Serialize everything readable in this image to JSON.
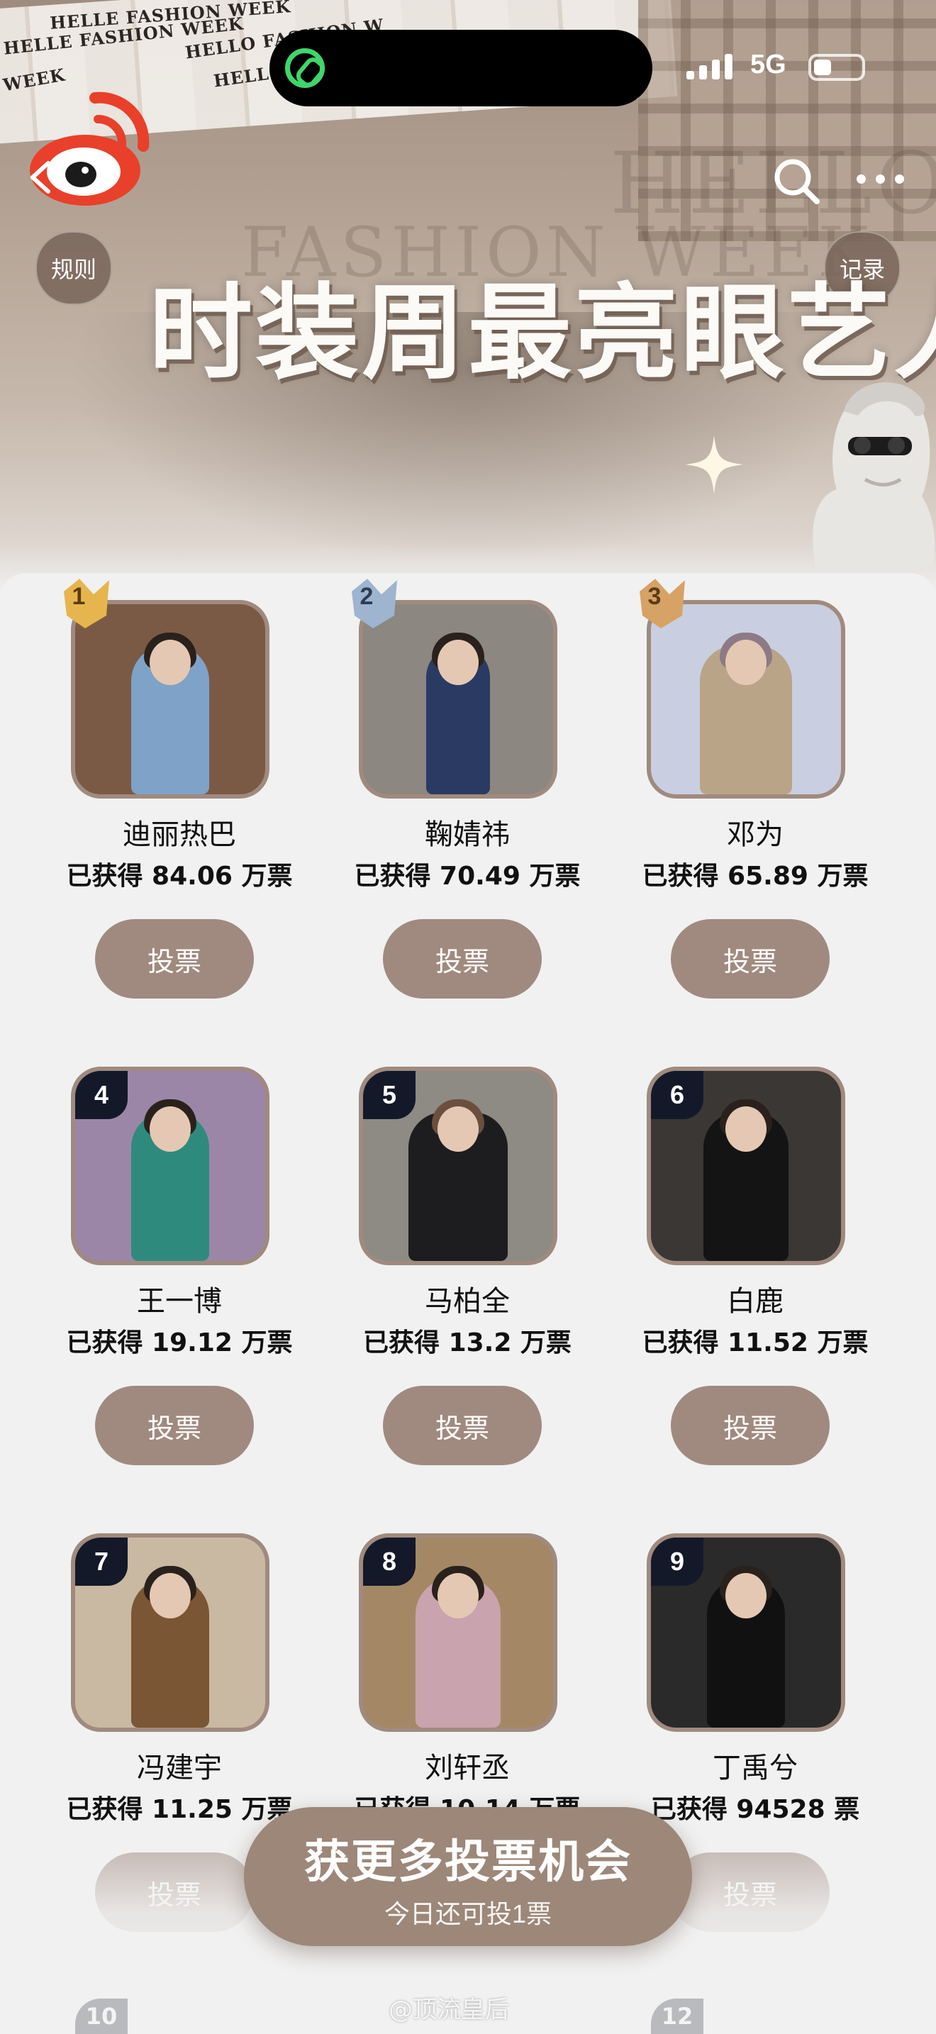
{
  "status_bar": {
    "network": "5G"
  },
  "header": {
    "title": "时装周最亮眼艺人",
    "rules_label": "规则",
    "records_label": "记录",
    "collage_words": [
      "HELLE FASHION WEEK",
      "HELLO FASHION W",
      "HELLO FASHION W",
      "HELLE FASHION WEEK",
      "WEEK"
    ],
    "background_word": "FASHION WEEK",
    "background_word_2": "HELLO"
  },
  "artists": [
    {
      "rank": "1",
      "name": "迪丽热巴",
      "votes": "已获得 84.06 万票",
      "vote_label": "投票",
      "photo_bg": "#7a5a44",
      "outfit": "#7fa2c8"
    },
    {
      "rank": "2",
      "name": "鞠婧祎",
      "votes": "已获得 70.49 万票",
      "vote_label": "投票",
      "photo_bg": "#8c8780",
      "outfit": "#2a3a63"
    },
    {
      "rank": "3",
      "name": "邓为",
      "votes": "已获得 65.89 万票",
      "vote_label": "投票",
      "photo_bg": "#c9cfe0",
      "outfit": "#b9a487"
    },
    {
      "rank": "4",
      "name": "王一博",
      "votes": "已获得 19.12 万票",
      "vote_label": "投票",
      "photo_bg": "#9b86a8",
      "outfit": "#2f8a7e"
    },
    {
      "rank": "5",
      "name": "马柏全",
      "votes": "已获得 13.2 万票",
      "vote_label": "投票",
      "photo_bg": "#8e8a84",
      "outfit": "#1d1d1f"
    },
    {
      "rank": "6",
      "name": "白鹿",
      "votes": "已获得 11.52 万票",
      "vote_label": "投票",
      "photo_bg": "#3b3734",
      "outfit": "#141414"
    },
    {
      "rank": "7",
      "name": "冯建宇",
      "votes": "已获得 11.25 万票",
      "vote_label": "投票",
      "photo_bg": "#c9b9a2",
      "outfit": "#7a5634"
    },
    {
      "rank": "8",
      "name": "刘轩丞",
      "votes": "已获得 10.14 万票",
      "vote_label": "投票",
      "photo_bg": "#a48866",
      "outfit": "#c9a3ad"
    },
    {
      "rank": "9",
      "name": "丁禹兮",
      "votes": "已获得 94528 票",
      "vote_label": "投票",
      "photo_bg": "#2a2a2a",
      "outfit": "#111111"
    }
  ],
  "peek_ranks": [
    "10",
    "12"
  ],
  "cta": {
    "title": "获更多投票机会",
    "subtitle": "今日还可投1票"
  },
  "watermark": "@顶流皇后",
  "colors": {
    "accent": "#a08a7f",
    "rank_tag": "#14192a",
    "gold": "#e7b54e",
    "silver": "#9eb4cf",
    "bronze": "#d6a265"
  }
}
